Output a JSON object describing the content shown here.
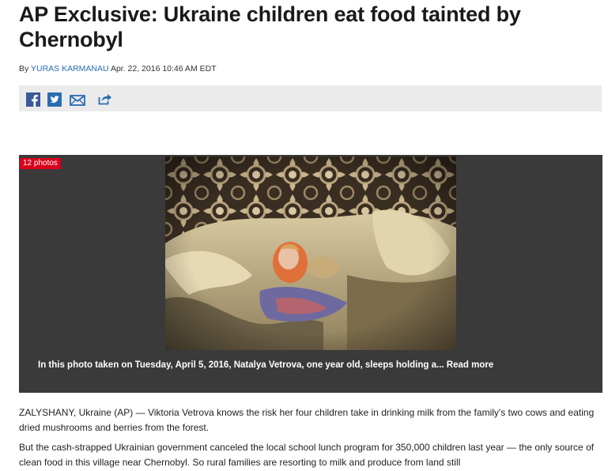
{
  "article": {
    "headline": "AP Exclusive: Ukraine children eat food tainted by Chernobyl",
    "byline_prefix": "By ",
    "author": "YURAS KARMANAU",
    "date": "Apr. 22, 2016 10:46 AM EDT"
  },
  "share": {
    "icons": [
      "facebook-icon",
      "twitter-icon",
      "email-icon",
      "share-icon"
    ],
    "colors": {
      "facebook": "#3b5998",
      "twitter": "#2a6db3",
      "email": "#2a6db3",
      "share": "#2a6db3"
    }
  },
  "gallery": {
    "photo_count": "12 photos",
    "caption": "In this photo taken on Tuesday, April 5, 2016, Natalya Vetrova, one year old, sleeps holding a...",
    "read_more": "Read more",
    "badge_color": "#d9001b"
  },
  "body": {
    "paragraphs": [
      "ZALYSHANY, Ukraine (AP) — Viktoria Vetrova knows the risk her four children take in drinking milk from the family's two cows and eating dried mushrooms and berries from the forest.",
      "But the cash-strapped Ukrainian government canceled the local school lunch program for 350,000 children last year — the only source of clean food in this village near Chernobyl. So rural families are resorting to milk and produce from land still"
    ]
  }
}
